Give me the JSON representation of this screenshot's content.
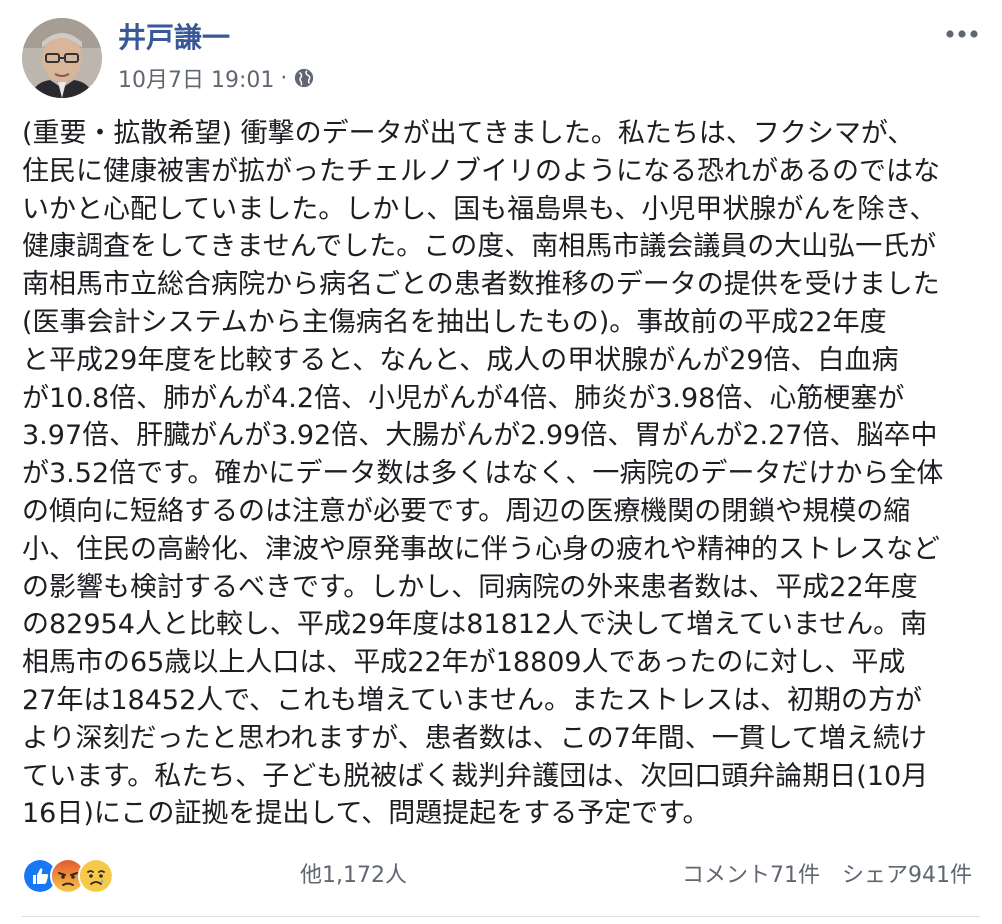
{
  "post": {
    "author": {
      "name": "井戸謙一",
      "avatar_icon": "profile-photo"
    },
    "timestamp": "10月7日 19:01",
    "meta_separator": "·",
    "privacy_icon": "globe-icon",
    "more_icon": "more-options-icon",
    "body": "(重要・拡散希望) 衝撃のデータが出てきました。私たちは、フクシマが、\n住民に健康被害が拡がったチェルノブイリのようになる恐れがあるのではな\nいかと心配していました。しかし、国も福島県も、小児甲状腺がんを除き、\n健康調査をしてきませんでした。この度、南相馬市議会議員の大山弘一氏が\n南相馬市立総合病院から病名ごとの患者数推移のデータの提供を受けました\n(医事会計システムから主傷病名を抽出したもの)。事故前の平成22年度\nと平成29年度を比較すると、なんと、成人の甲状腺がんが29倍、白血病\nが10.8倍、肺がんが4.2倍、小児がんが4倍、肺炎が3.98倍、心筋梗塞が\n3.97倍、肝臓がんが3.92倍、大腸がんが2.99倍、胃がんが2.27倍、脳卒中\nが3.52倍です。確かにデータ数は多くはなく、一病院のデータだけから全体\nの傾向に短絡するのは注意が必要です。周辺の医療機関の閉鎖や規模の縮\n小、住民の高齢化、津波や原発事故に伴う心身の疲れや精神的ストレスなど\nの影響も検討するべきです。しかし、同病院の外来患者数は、平成22年度\nの82954人と比較し、平成29年度は81812人で決して増えていません。南\n相馬市の65歳以上人口は、平成22年が18809人であったのに対し、平成\n27年は18452人で、これも増えていません。またストレスは、初期の方が\nより深刻だったと思われますが、患者数は、この7年間、一貫して増え続け\nています。私たち、子ども脱被ばく裁判弁護団は、次回口頭弁論期日(10月\n16日)にこの証拠を提出して、問題提起をする予定です。",
    "reactions": {
      "icons": [
        "like-icon",
        "angry-icon",
        "sad-icon"
      ],
      "count_text": "他1,172人"
    },
    "comments_text": "コメント71件",
    "shares_text": "シェア941件"
  },
  "colors": {
    "author_name": "#385898",
    "meta_text": "#606770",
    "body_text": "#1c1e21",
    "like_blue": "#1877f2",
    "angry_red": "#e4582c",
    "sad_yellow": "#f7c94a",
    "divider": "#dadde1"
  }
}
